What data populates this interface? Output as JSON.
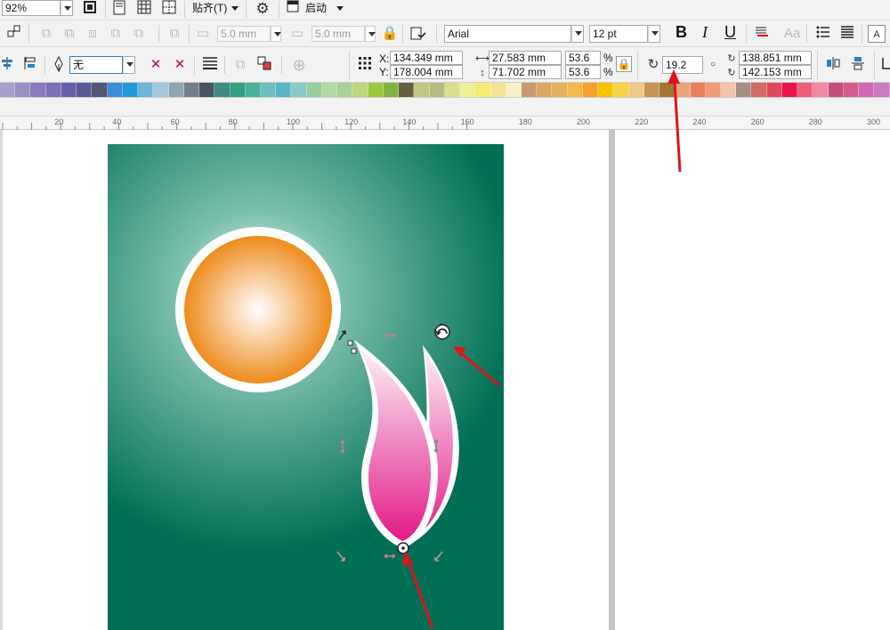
{
  "toolbar1": {
    "zoom_value": "92%",
    "snap_label": "贴齐(T)",
    "launch_label": "启动"
  },
  "toolbar2": {
    "offset_x": "5.0 mm",
    "offset_y": "5.0 mm",
    "font_name": "Arial",
    "font_size": "12 pt",
    "bold_label": "B",
    "italic_label": "I",
    "underline_label": "U"
  },
  "toolbar3": {
    "fill_value": "无",
    "x_label": "X:",
    "y_label": "Y:",
    "x_value": "134.349 mm",
    "y_value": "178.004 mm",
    "width_value": "27.583 mm",
    "height_value": "71.702 mm",
    "scale_x": "53.6",
    "scale_y": "53.6",
    "percent_x": "%",
    "percent_y": "%",
    "rotation_value": "19.2",
    "center_x": "138.851 mm",
    "center_y": "142.153 mm"
  },
  "ruler": {
    "ticks": [
      "20",
      "40",
      "60",
      "80",
      "100",
      "120",
      "140",
      "160",
      "180",
      "200",
      "220",
      "240",
      "260",
      "280",
      "300"
    ]
  },
  "palette_colors": [
    "#a7a0c8",
    "#9a8fc3",
    "#8b79bd",
    "#7e6eb5",
    "#6560a8",
    "#585b93",
    "#525774",
    "#3b8ed7",
    "#1e9ad8",
    "#6cb5d7",
    "#a6c7d8",
    "#8fa5b1",
    "#727f8a",
    "#4a5562",
    "#3f8b83",
    "#31a085",
    "#48b09c",
    "#6cc0bc",
    "#57b7c6",
    "#8bc9c8",
    "#99cf9b",
    "#b4d9a4",
    "#a7d197",
    "#bcd67a",
    "#9cc83b",
    "#7fb23e",
    "#685e3e",
    "#c0c784",
    "#b6bb81",
    "#d9df8b",
    "#ecef92",
    "#f2ec74",
    "#f3e495",
    "#f4f1c8",
    "#c79a73",
    "#dca661",
    "#e5b15c",
    "#f2ba47",
    "#f59f2c",
    "#f6c300",
    "#f8d24a",
    "#efc888",
    "#c59455",
    "#a3752f",
    "#e8a57b",
    "#e87f5a",
    "#ef9a79",
    "#f4c4ae",
    "#a88d86",
    "#cf6b61",
    "#e2475b",
    "#e8134c",
    "#ec5f79",
    "#ef8aa0",
    "#c34f7a",
    "#d55c8a",
    "#d06ab0",
    "#c97bc0"
  ],
  "artwork": {
    "background_dark": "#006f55",
    "background_light": "#f2fbf8",
    "sun_inner": "#ffffff",
    "sun_outer": "#ee8a1a",
    "petal_outer": "#e21584",
    "petal_inner": "#fbeaf4",
    "arrow_color": "#e0131b"
  }
}
